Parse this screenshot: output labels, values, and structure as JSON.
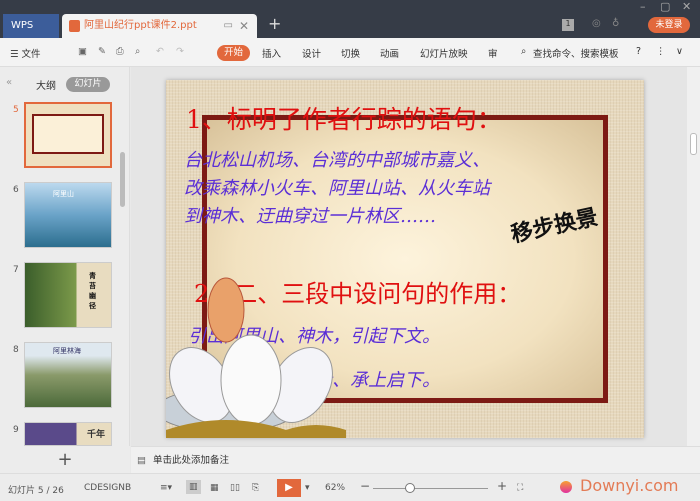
{
  "titlebar": {
    "app_tab": "WPS",
    "doc_tab": "阿里山纪行ppt课件2.ppt",
    "page_badge": "1",
    "login": "未登录"
  },
  "toolbar": {
    "file": "☰ 文件",
    "tabs": [
      "开始",
      "插入",
      "设计",
      "切换",
      "动画",
      "幻灯片放映",
      "审"
    ],
    "search": "查找命令、搜索模板",
    "help": "?"
  },
  "left_panel": {
    "tab_outline": "大纲",
    "tab_slides": "幻灯片",
    "slide_numbers": [
      "5",
      "6",
      "7",
      "8",
      "9"
    ],
    "thumb6_title": "阿里山",
    "thumb7_title": "青苔幽径",
    "thumb8_title": "阿里林海",
    "thumb9_title": "千年"
  },
  "slide": {
    "heading1": "1、标明了作者行踪的语句：",
    "body1": [
      "台北松山机场、台湾的中部城市嘉义、",
      "改乘森林小火车、阿里山站、从火车站",
      "到神木、迂曲穿过一片林区……"
    ],
    "stamp": "移步换景",
    "heading2": "2、二、三段中设问句的作用：",
    "body2": [
      "引出阿里山、神木，引起下文。",
      "三段作用：过渡段、承上启下。"
    ]
  },
  "notes": {
    "placeholder": "单击此处添加备注"
  },
  "status": {
    "slide_counter": "幻灯片 5 / 26",
    "theme": "CDESIGNB",
    "zoom": "62%",
    "zoom_level_percent": 62,
    "watermark": "Downyi.com"
  },
  "colors": {
    "accent": "#e2683c",
    "heading": "#e01010",
    "body": "#5b2fd6",
    "frame": "#7d1a14"
  }
}
